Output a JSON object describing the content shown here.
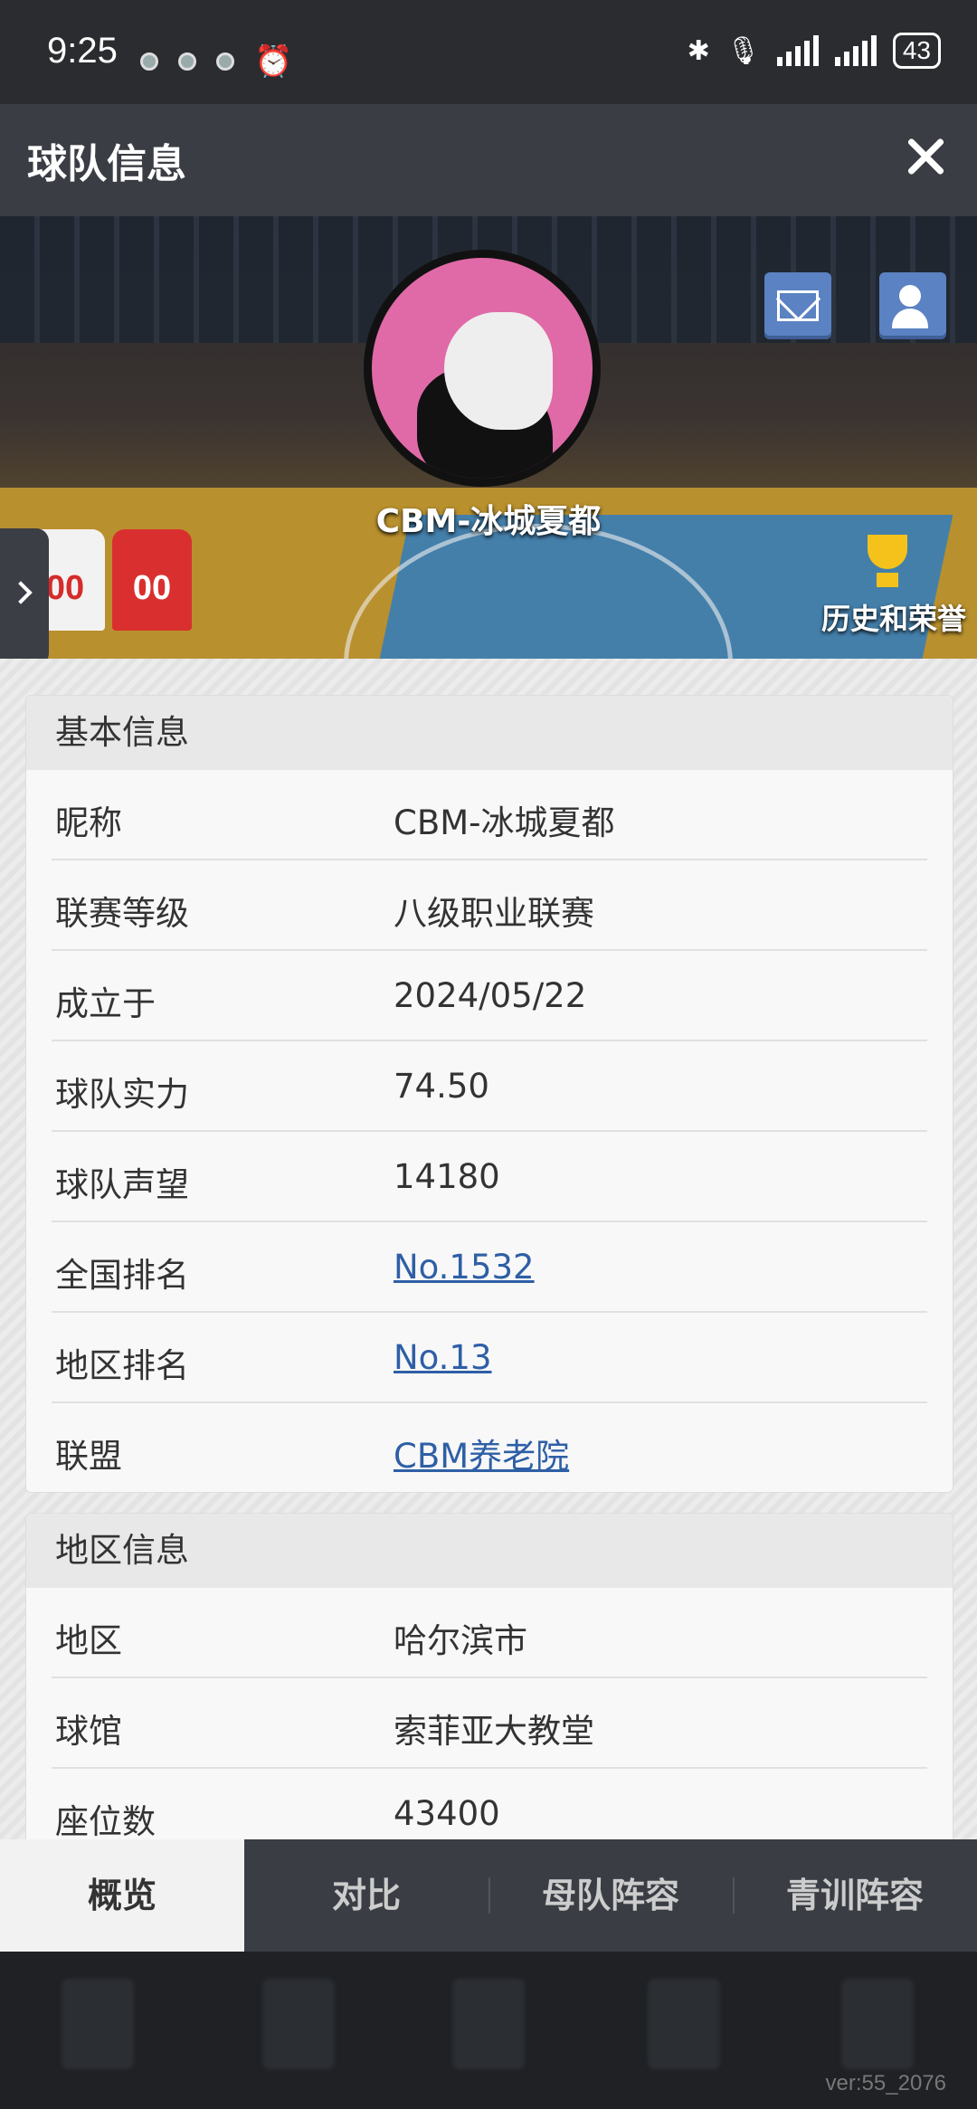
{
  "status": {
    "time": "9:25",
    "battery": "43"
  },
  "header": {
    "title": "球队信息"
  },
  "banner": {
    "team_name": "CBM-冰城夏都",
    "jersey_number": "00",
    "honors_label": "历史和荣誉"
  },
  "basic_info": {
    "title": "基本信息",
    "rows": [
      {
        "label": "昵称",
        "value": "CBM-冰城夏都"
      },
      {
        "label": "联赛等级",
        "value": "八级职业联赛"
      },
      {
        "label": "成立于",
        "value": "2024/05/22"
      },
      {
        "label": "球队实力",
        "value": "74.50"
      },
      {
        "label": "球队声望",
        "value": "14180"
      },
      {
        "label": "全国排名",
        "value": "No.1532"
      },
      {
        "label": "地区排名",
        "value": "No.13"
      },
      {
        "label": "联盟",
        "value": "CBM养老院"
      }
    ]
  },
  "region_info": {
    "title": "地区信息",
    "rows": [
      {
        "label": "地区",
        "value": "哈尔滨市"
      },
      {
        "label": "球馆",
        "value": "索菲亚大教堂"
      },
      {
        "label": "座位数",
        "value": "43400"
      }
    ]
  },
  "tabs": [
    "概览",
    "对比",
    "母队阵容",
    "青训阵容"
  ],
  "version": "ver:55_2076"
}
